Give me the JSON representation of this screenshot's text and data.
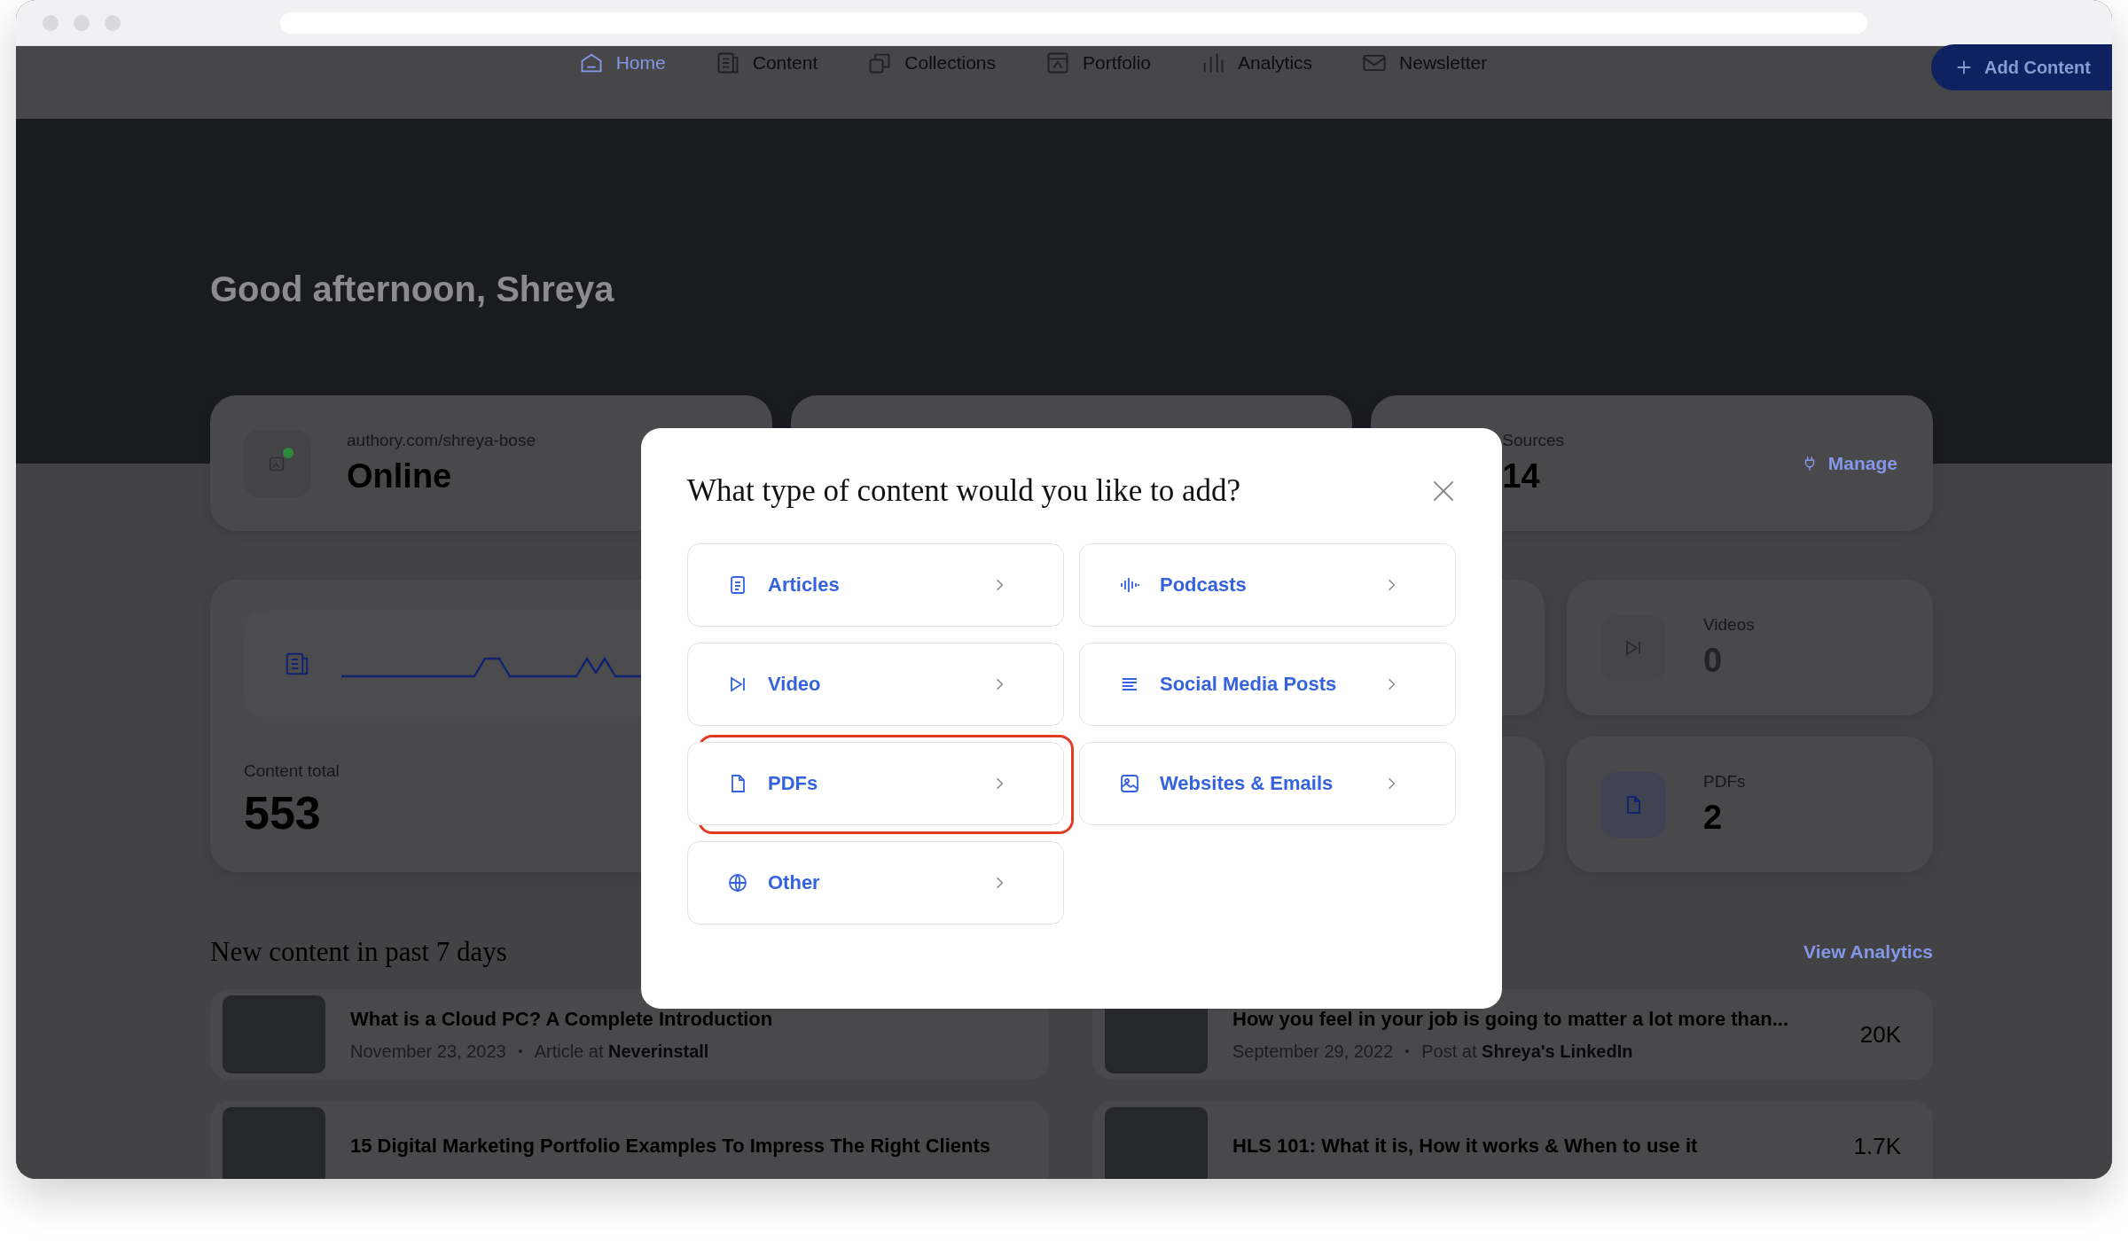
{
  "nav": {
    "items": [
      {
        "label": "Home",
        "kind": "home",
        "selected": true
      },
      {
        "label": "Content",
        "kind": "content",
        "selected": false
      },
      {
        "label": "Collections",
        "kind": "collections",
        "selected": false
      },
      {
        "label": "Portfolio",
        "kind": "portfolio",
        "selected": false
      },
      {
        "label": "Analytics",
        "kind": "analytics",
        "selected": false
      },
      {
        "label": "Newsletter",
        "kind": "newsletter",
        "selected": false
      }
    ],
    "add_button": "Add Content"
  },
  "greeting": "Good afternoon, Shreya",
  "site_card": {
    "url": "authory.com/shreya-bose",
    "status": "Online",
    "online": true
  },
  "sources_card": {
    "label": "Sources",
    "value": "14",
    "action": "Manage"
  },
  "content_total": {
    "label": "Content total",
    "value": "553"
  },
  "stat_cards": [
    {
      "label": "Videos",
      "value": "0",
      "kind": "video",
      "empty": true
    },
    {
      "label": "PDFs",
      "value": "2",
      "kind": "pdf",
      "empty": false
    }
  ],
  "recent": {
    "heading": "New content in past 7 days",
    "link": "View Analytics",
    "items": [
      {
        "title": "What is a Cloud PC? A Complete Introduction",
        "date": "November 23, 2023",
        "type": "Article at",
        "source": "Neverinstall"
      },
      {
        "title": "How you feel in your job is going to matter a lot more than...",
        "date": "September 29, 2022",
        "type": "Post at",
        "source": "Shreya's LinkedIn",
        "count": "20K"
      },
      {
        "title": "15 Digital Marketing Portfolio Examples To Impress The Right Clients"
      },
      {
        "title": "HLS 101: What it is, How it works & When to use it",
        "count": "1.7K"
      }
    ]
  },
  "modal": {
    "title": "What type of content would you like to add?",
    "options": [
      {
        "label": "Articles",
        "kind": "article",
        "highlighted": false
      },
      {
        "label": "Podcasts",
        "kind": "podcast",
        "highlighted": false
      },
      {
        "label": "Video",
        "kind": "video",
        "highlighted": false
      },
      {
        "label": "Social Media Posts",
        "kind": "social",
        "highlighted": false
      },
      {
        "label": "PDFs",
        "kind": "pdf",
        "highlighted": true
      },
      {
        "label": "Websites & Emails",
        "kind": "website",
        "highlighted": false
      },
      {
        "label": "Other",
        "kind": "other",
        "highlighted": false
      }
    ]
  }
}
